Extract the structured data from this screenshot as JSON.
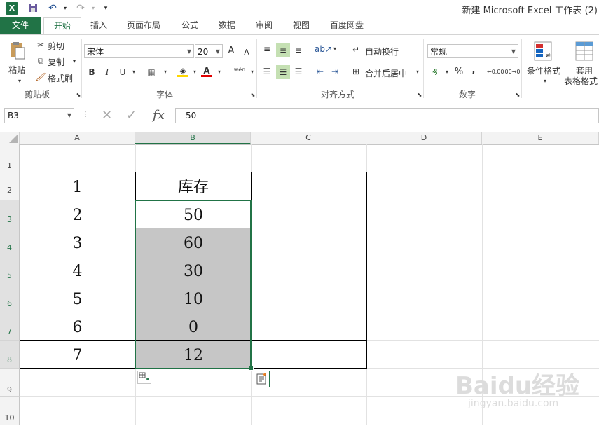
{
  "window": {
    "title": "新建 Microsoft Excel 工作表 (2)"
  },
  "qat": {
    "logo": "X",
    "icons": [
      "save-icon",
      "undo-icon",
      "redo-icon",
      "customize-icon"
    ]
  },
  "tabs": [
    "文件",
    "开始",
    "插入",
    "页面布局",
    "公式",
    "数据",
    "审阅",
    "视图",
    "百度网盘"
  ],
  "ribbon": {
    "clipboard": {
      "paste": "粘贴",
      "cut": "剪切",
      "copy": "复制",
      "format_painter": "格式刷",
      "label": "剪贴板"
    },
    "font": {
      "name": "宋体",
      "size": "20",
      "bold": "B",
      "italic": "I",
      "underline": "U",
      "grow": "A",
      "shrink": "A",
      "phonetic": "wén",
      "label": "字体"
    },
    "alignment": {
      "wrap": "自动换行",
      "merge": "合并后居中",
      "label": "对齐方式"
    },
    "number": {
      "format": "常规",
      "percent": "%",
      "comma": ",",
      "label": "数字"
    },
    "styles": {
      "conditional": "条件格式",
      "table_line1": "套用",
      "table_line2": "表格格式"
    }
  },
  "formula_bar": {
    "name_box": "B3",
    "fx": "fx",
    "value": "50"
  },
  "columns": [
    "A",
    "B",
    "C",
    "D",
    "E"
  ],
  "rows": [
    "1",
    "2",
    "3",
    "4",
    "5",
    "6",
    "7",
    "8",
    "9",
    "10"
  ],
  "cells": {
    "a": [
      "1",
      "2",
      "3",
      "4",
      "5",
      "6",
      "7"
    ],
    "b": [
      "库存",
      "50",
      "60",
      "30",
      "10",
      "0",
      "12"
    ]
  },
  "watermark": {
    "text": "Baidu经验",
    "sub": "jingyan.baidu.com"
  }
}
